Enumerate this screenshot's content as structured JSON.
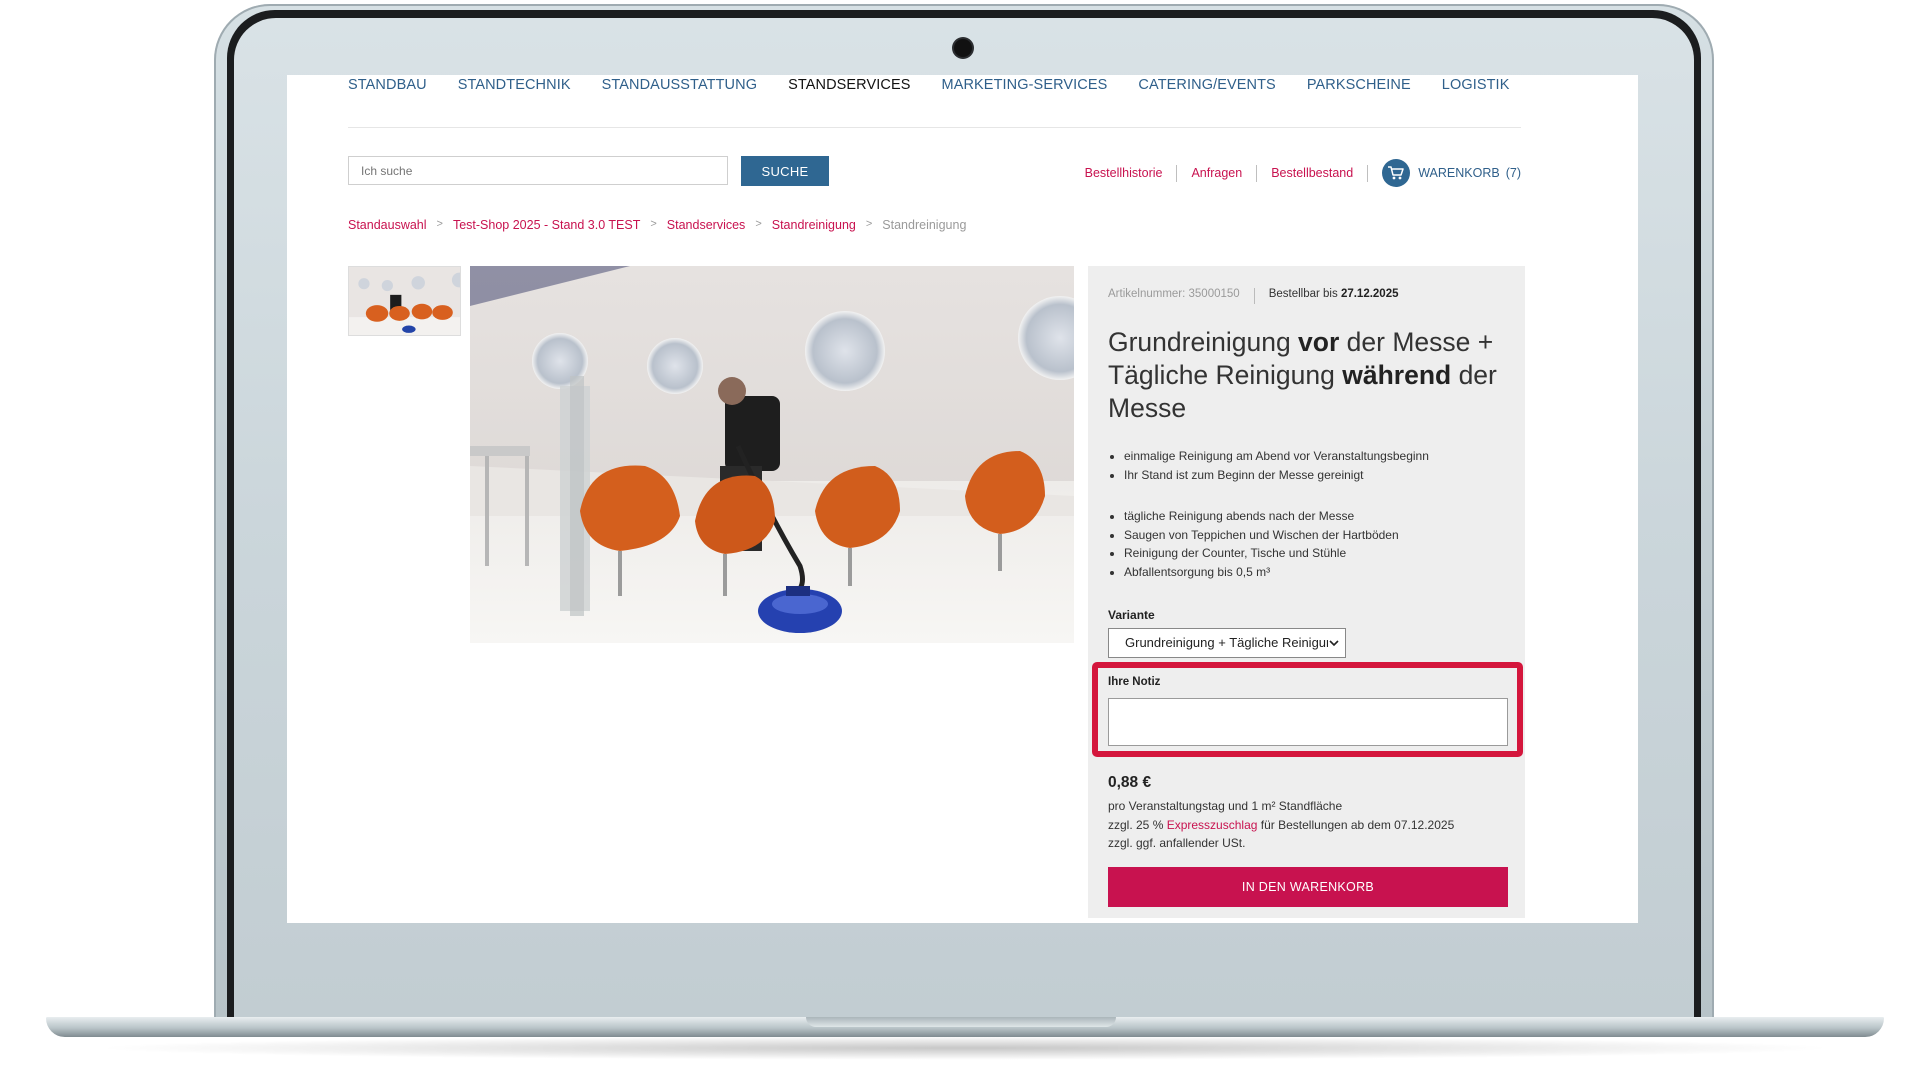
{
  "nav": {
    "items": [
      {
        "label": "STANDBAU"
      },
      {
        "label": "STANDTECHNIK"
      },
      {
        "label": "STANDAUSSTATTUNG"
      },
      {
        "label": "STANDSERVICES",
        "active": true
      },
      {
        "label": "MARKETING-SERVICES"
      },
      {
        "label": "CATERING/EVENTS"
      },
      {
        "label": "PARKSCHEINE"
      },
      {
        "label": "LOGISTIK"
      }
    ]
  },
  "search": {
    "placeholder": "Ich suche",
    "button_label": "SUCHE"
  },
  "top_links": {
    "history": "Bestellhistorie",
    "requests": "Anfragen",
    "stock": "Bestellbestand",
    "cart_label": "WARENKORB",
    "cart_count": "(7)"
  },
  "breadcrumb": [
    {
      "label": "Standauswahl"
    },
    {
      "label": "Test-Shop 2025 - Stand 3.0 TEST"
    },
    {
      "label": "Standservices"
    },
    {
      "label": "Standreinigung"
    },
    {
      "label": "Standreinigung",
      "current": true
    }
  ],
  "product": {
    "article_number": "Artikelnummer: 35000150",
    "orderable_prefix": "Bestellbar bis",
    "orderable_date": "27.12.2025",
    "title_parts": [
      "Grundreinigung ",
      "vor",
      " der Messe + Tägliche Reinigung ",
      "während",
      " der Messe"
    ],
    "features_1": [
      "einmalige Reinigung am Abend vor Veranstaltungsbeginn",
      "Ihr Stand ist zum Beginn der Messe gereinigt"
    ],
    "features_2": [
      "tägliche Reinigung abends nach der Messe",
      "Saugen von Teppichen und Wischen der Hartböden",
      "Reinigung der Counter, Tische und Stühle",
      "Abfallentsorgung bis 0,5 m³"
    ],
    "variant_label": "Variante",
    "variant_value": "Grundreinigung + Tägliche Reinigung",
    "note_label": "Ihre Notiz",
    "note_value": "",
    "price": "0,88 €",
    "price_unit": "pro Veranstaltungstag und 1 m² Standfläche",
    "surcharge_prefix": "zzgl. 25 %",
    "surcharge_link": "Expresszuschlag",
    "surcharge_suffix": "für Bestellungen ab dem 07.12.2025",
    "tax_note": "zzgl. ggf. anfallender USt.",
    "cart_button": "IN DEN WARENKORB"
  },
  "colors": {
    "nav_blue": "#2f5f8a",
    "button_blue": "#2f6792",
    "brand_magenta": "#c8124f",
    "highlight_red": "#d4163c",
    "panel_bg": "#eeeeee"
  },
  "icons": {
    "cart": "shopping-cart-icon",
    "select": "chevron-down-icon",
    "camera": "camera-icon"
  }
}
